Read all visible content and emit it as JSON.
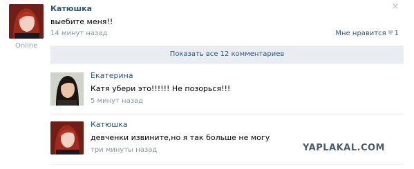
{
  "post": {
    "author": "Катюшка",
    "text": "выебите меня!!",
    "date": "14 минут назад",
    "status": "Online",
    "like_label": "Мне нравится",
    "like_count": "1"
  },
  "show_all_comments": "Показать все 12 комментариев",
  "comments": [
    {
      "author": "Екатерина",
      "text": "Катя убери это!!!!!! Не позорься!!!",
      "date": "5 минут назад"
    },
    {
      "author": "Катюшка",
      "text": "девченки извините,но я так больше не могу",
      "date": "три минуты назад"
    }
  ],
  "watermark": "YAPLAKAL.COM",
  "icons": {
    "close": "close-icon",
    "like": "heart-icon"
  },
  "colors": {
    "link": "#2b587a",
    "muted": "#8a96a3",
    "bar": "#e9edf1"
  }
}
